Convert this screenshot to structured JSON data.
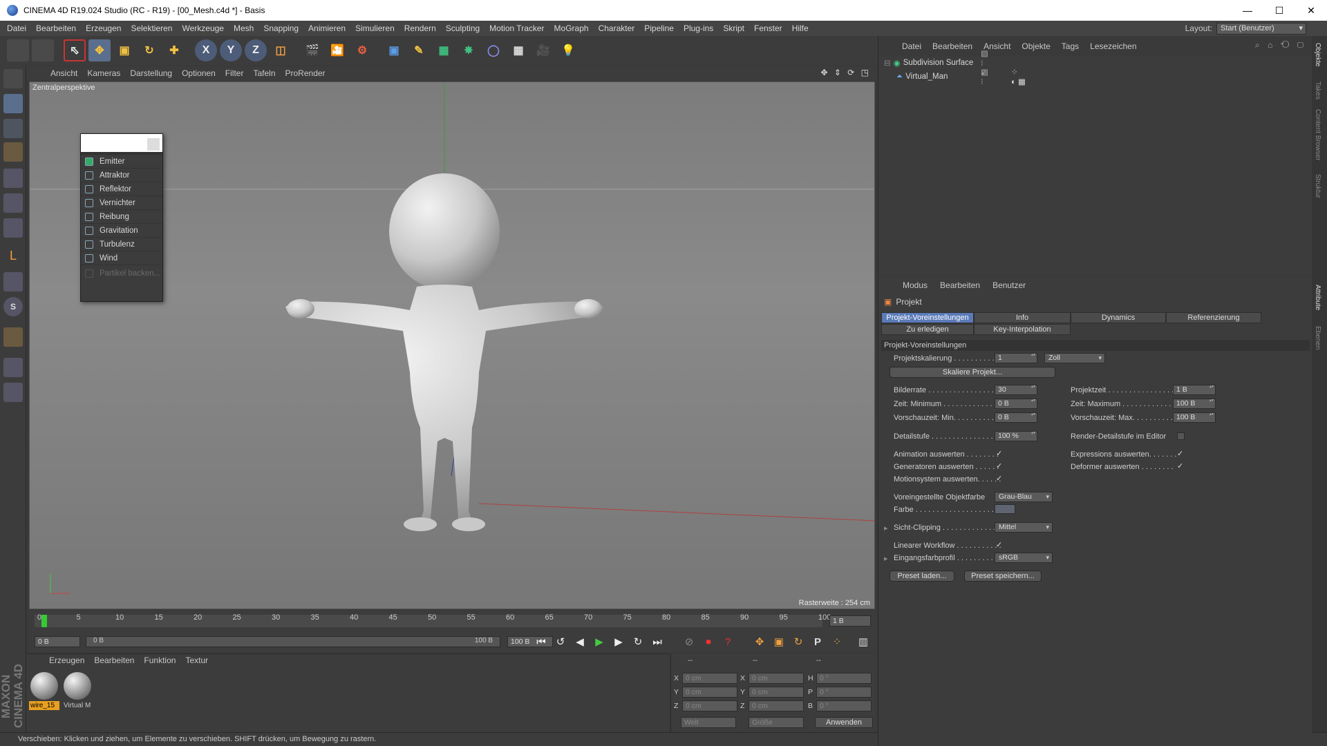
{
  "window": {
    "title": "CINEMA 4D R19.024 Studio (RC - R19) - [00_Mesh.c4d *] - Basis"
  },
  "menu": [
    "Datei",
    "Bearbeiten",
    "Erzeugen",
    "Selektieren",
    "Werkzeuge",
    "Mesh",
    "Snapping",
    "Animieren",
    "Simulieren",
    "Rendern",
    "Sculpting",
    "Motion Tracker",
    "MoGraph",
    "Charakter",
    "Pipeline",
    "Plug-ins",
    "Skript",
    "Fenster",
    "Hilfe"
  ],
  "layout": {
    "label": "Layout:",
    "value": "Start (Benutzer)"
  },
  "viewport": {
    "menu": [
      "Ansicht",
      "Kameras",
      "Darstellung",
      "Optionen",
      "Filter",
      "Tafeln",
      "ProRender"
    ],
    "label": "Zentralperspektive",
    "raster": "Rasterweite : 254 cm"
  },
  "popup": {
    "items": [
      "Emitter",
      "Attraktor",
      "Reflektor",
      "Vernichter",
      "Reibung",
      "Gravitation",
      "Turbulenz",
      "Wind"
    ],
    "disabled": "Partikel backen..."
  },
  "timeline": {
    "ticks": [
      "0",
      "5",
      "10",
      "15",
      "20",
      "25",
      "30",
      "35",
      "40",
      "45",
      "50",
      "55",
      "60",
      "65",
      "70",
      "75",
      "80",
      "85",
      "90",
      "95",
      "100"
    ],
    "current_frame_field": "1 B"
  },
  "transport": {
    "start": "0 B",
    "range_start": "0 B",
    "range_end": "100 B",
    "end": "100 B"
  },
  "materials": {
    "menu": [
      "Erzeugen",
      "Bearbeiten",
      "Funktion",
      "Textur"
    ],
    "items": [
      {
        "label": "wire_15"
      },
      {
        "label": "Virtual M"
      }
    ]
  },
  "coords": {
    "header": [
      "--",
      "--",
      "--"
    ],
    "rows": [
      {
        "a": "X",
        "av": "0 cm",
        "b": "X",
        "bv": "0 cm",
        "c": "H",
        "cv": "0 °"
      },
      {
        "a": "Y",
        "av": "0 cm",
        "b": "Y",
        "bv": "0 cm",
        "c": "P",
        "cv": "0 °"
      },
      {
        "a": "Z",
        "av": "0 cm",
        "b": "Z",
        "bv": "0 cm",
        "c": "B",
        "cv": "0 °"
      }
    ],
    "mode1": "Welt",
    "mode2": "Größe",
    "apply": "Anwenden"
  },
  "status": "Verschieben: Klicken und ziehen, um Elemente zu verschieben. SHIFT drücken, um Bewegung zu rastern.",
  "maxon": "MAXON CINEMA 4D",
  "objects": {
    "menu": [
      "Datei",
      "Bearbeiten",
      "Ansicht",
      "Objekte",
      "Tags",
      "Lesezeichen"
    ],
    "tree": [
      "Subdivision Surface",
      "Virtual_Man"
    ]
  },
  "attributes": {
    "menu": [
      "Modus",
      "Bearbeiten",
      "Benutzer"
    ],
    "header": "Projekt",
    "tabs": [
      "Projekt-Voreinstellungen",
      "Info",
      "Dynamics",
      "Referenzierung",
      "Zu erledigen",
      "Key-Interpolation"
    ],
    "section": "Projekt-Voreinstellungen",
    "scale_label": "Projektskalierung . . . . . . . . . .",
    "scale_value": "1",
    "scale_unit": "Zoll",
    "scale_button": "Skaliere Projekt...",
    "fps_label": "Bilderrate . . . . . . . . . . . . . . . . . .",
    "fps": "30",
    "tmin_label": "Zeit: Minimum . . . . . . . . . . . . . .",
    "tmin": "0 B",
    "pmin_label": "Vorschauzeit: Min. . . . . . . . . . .",
    "pmin": "0 B",
    "ptime_label": "Projektzeit . . . . . . . . . . . . . . . .",
    "ptime": "1 B",
    "tmax_label": "Zeit: Maximum . . . . . . . . . . . . .",
    "tmax": "100 B",
    "pmax_label": "Vorschauzeit: Max. . . . . . . . . .",
    "pmax": "100 B",
    "lod_label": "Detailstufe . . . . . . . . . . . . . . . .",
    "lod": "100 %",
    "rlod_label": "Render-Detailstufe im Editor",
    "anim_label": "Animation auswerten . . . . . . . .",
    "gen_label": "Generatoren auswerten . . . . . .",
    "motion_label": "Motionsystem auswerten. . . . . .",
    "expr_label": "Expressions auswerten. . . . . . .",
    "def_label": "Deformer auswerten . . . . . . . .",
    "objcolor_label": "Voreingestellte Objektfarbe",
    "objcolor": "Grau-Blau",
    "color_label": "Farbe . . . . . . . . . . . . . . . . . . . . .",
    "clip_label": "Sicht-Clipping . . . . . . . . . . . . .",
    "clip": "Mittel",
    "linear_label": "Linearer Workflow . . . . . . . . . . .",
    "profile_label": "Eingangsfarbprofil . . . . . . . . . .",
    "profile": "sRGB",
    "load": "Preset laden...",
    "save": "Preset speichern..."
  },
  "side_tabs": [
    "Objekte",
    "Takes",
    "Content Browser",
    "Struktur",
    "Attribute",
    "Ebenen"
  ],
  "colors": {
    "accent": "#5b7ab8",
    "bg": "#3c3c3c",
    "viewport": "#808080"
  }
}
